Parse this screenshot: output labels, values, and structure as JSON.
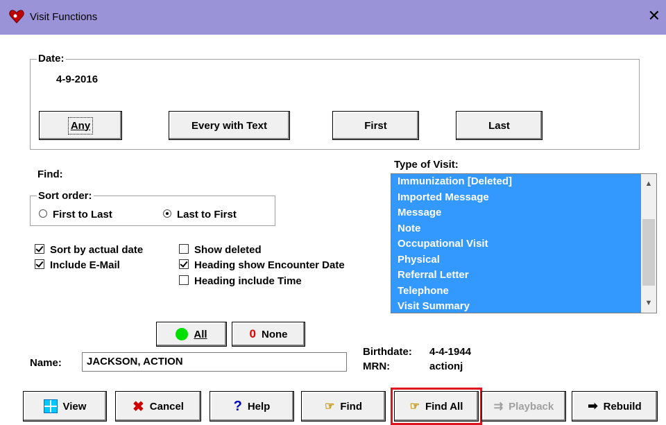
{
  "window": {
    "title": "Visit Functions",
    "close_glyph": "✕"
  },
  "date_group": {
    "label": "Date:",
    "value": "4-9-2016",
    "buttons": {
      "any": "Any",
      "every_with_text": "Every with Text",
      "first": "First",
      "last": "Last"
    }
  },
  "find_label": "Find:",
  "sort_order": {
    "label": "Sort order:",
    "first_to_last": "First to Last",
    "last_to_first": "Last to First",
    "selected": "last_to_first"
  },
  "options": {
    "sort_by_actual_date": {
      "label": "Sort by actual date",
      "checked": true
    },
    "include_email": {
      "label": "Include E-Mail",
      "checked": true
    },
    "show_deleted": {
      "label": "Show deleted",
      "checked": false
    },
    "heading_show_encounter_date": {
      "label": "Heading show Encounter Date",
      "checked": true
    },
    "heading_include_time": {
      "label": "Heading include Time",
      "checked": false
    }
  },
  "type_of_visit": {
    "label": "Type of Visit:",
    "items": [
      "Immunization [Deleted]",
      "Imported Message",
      "Message",
      "Note",
      "Occupational Visit",
      "Physical",
      "Referral Letter",
      "Telephone",
      "Visit Summary"
    ]
  },
  "select_buttons": {
    "all": "All",
    "none": "None",
    "none_icon_glyph": "0"
  },
  "patient": {
    "name_label": "Name:",
    "name_value": "JACKSON, ACTION",
    "birthdate_label": "Birthdate:",
    "birthdate_value": "4-4-1944",
    "mrn_label": "MRN:",
    "mrn_value": "actionj"
  },
  "bottom_buttons": {
    "view": "View",
    "cancel": "Cancel",
    "help": "Help",
    "find": "Find",
    "find_all": "Find All",
    "playback": "Playback",
    "rebuild": "Rebuild"
  },
  "colors": {
    "titlebar": "#9b93d8",
    "selection": "#3399ff",
    "highlight_border": "#e0141e"
  }
}
